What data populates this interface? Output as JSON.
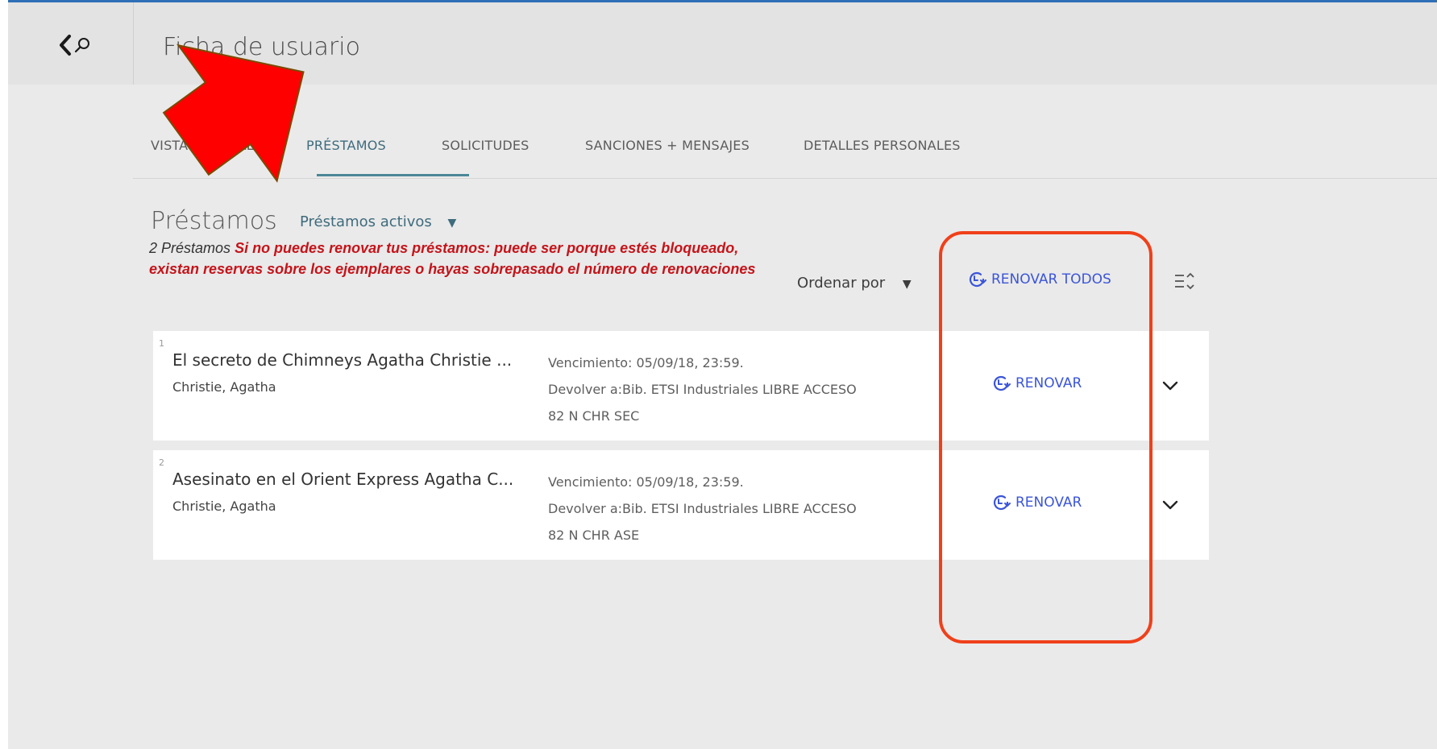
{
  "header": {
    "title": "Ficha de usuario",
    "back_icon": "back-search-icon"
  },
  "tabs": [
    {
      "label": "VISTA GENERAL",
      "active": false
    },
    {
      "label": "PRÉSTAMOS",
      "active": true
    },
    {
      "label": "SOLICITUDES",
      "active": false
    },
    {
      "label": "SANCIONES + MENSAJES",
      "active": false
    },
    {
      "label": "DETALLES PERSONALES",
      "active": false
    }
  ],
  "loans": {
    "title": "Préstamos",
    "filter": {
      "selected": "Préstamos activos"
    },
    "count_text": "2 Préstamos",
    "notice": "Si no puedes renovar tus préstamos: puede ser porque estés bloqueado, existan reservas sobre los ejemplares o hayas sobrepasado el número de renovaciones",
    "sort_label": "Ordenar por",
    "renew_all_label": "RENOVAR TODOS",
    "items": [
      {
        "index": "1",
        "title": "El secreto de Chimneys Agatha Christie ...",
        "author": "Christie, Agatha",
        "due": "Vencimiento: 05/09/18, 23:59.",
        "return_to": "Devolver a:Bib. ETSI Industriales LIBRE ACCESO",
        "call_number": "82 N CHR SEC",
        "renew_label": "RENOVAR"
      },
      {
        "index": "2",
        "title": "Asesinato en el Orient Express Agatha C...",
        "author": "Christie, Agatha",
        "due": "Vencimiento: 05/09/18, 23:59.",
        "return_to": "Devolver a:Bib. ETSI Industriales LIBRE ACCESO",
        "call_number": "82 N CHR ASE",
        "renew_label": "RENOVAR"
      }
    ]
  },
  "colors": {
    "accent": "#3b55d9",
    "tab_active": "#3e6b7d",
    "notice_red": "#c4141a",
    "annotation_red": "#f0401a"
  }
}
